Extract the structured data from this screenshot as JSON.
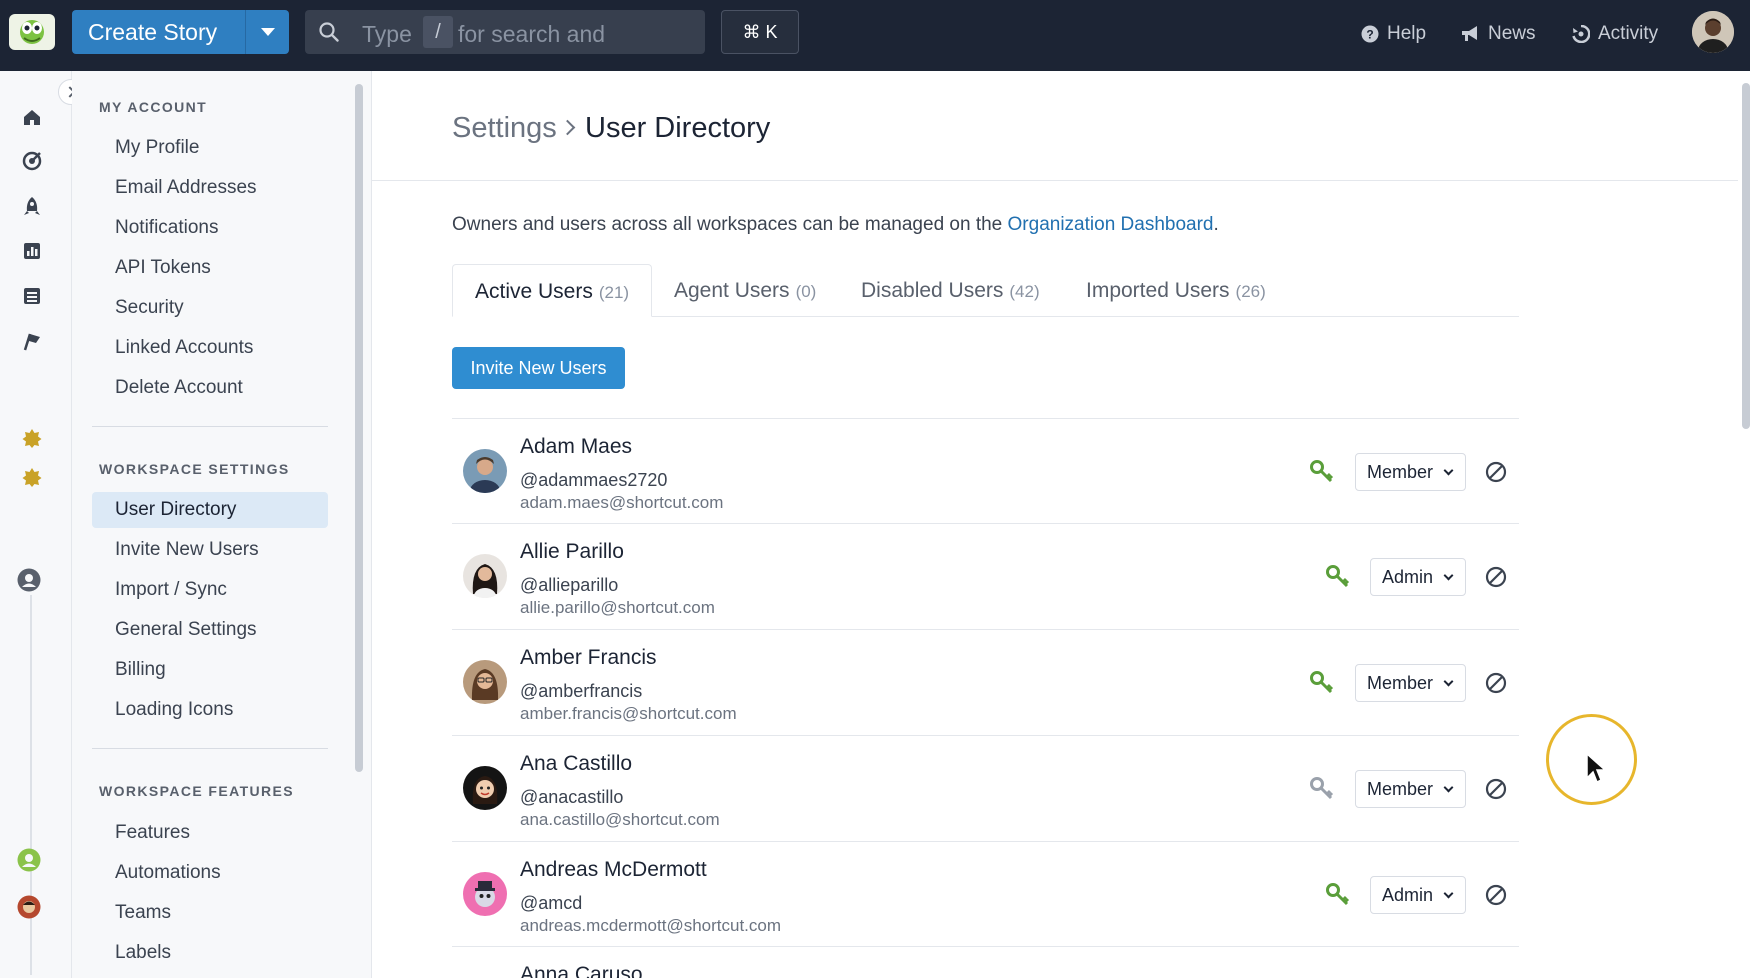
{
  "topbar": {
    "create_label": "Create Story",
    "search_type": "Type",
    "search_slash": "/",
    "search_rest": "for search and",
    "shortcut": "⌘ K",
    "help": "Help",
    "news": "News",
    "activity": "Activity"
  },
  "nav": {
    "my_account_heading": "MY ACCOUNT",
    "my_account_items": [
      "My Profile",
      "Email Addresses",
      "Notifications",
      "API Tokens",
      "Security",
      "Linked Accounts",
      "Delete Account"
    ],
    "workspace_settings_heading": "WORKSPACE SETTINGS",
    "workspace_settings_items": [
      "User Directory",
      "Invite New Users",
      "Import / Sync",
      "General Settings",
      "Billing",
      "Loading Icons"
    ],
    "workspace_features_heading": "WORKSPACE FEATURES",
    "workspace_features_items": [
      "Features",
      "Automations",
      "Teams",
      "Labels"
    ]
  },
  "breadcrumb": {
    "parent": "Settings",
    "current": "User Directory"
  },
  "intro": {
    "text_before": "Owners and users across all workspaces can be managed on the ",
    "link": "Organization Dashboard",
    "text_after": "."
  },
  "tabs": [
    {
      "label": "Active Users",
      "count": "(21)"
    },
    {
      "label": "Agent Users",
      "count": "(0)"
    },
    {
      "label": "Disabled Users",
      "count": "(42)"
    },
    {
      "label": "Imported Users",
      "count": "(26)"
    }
  ],
  "invite_label": "Invite New Users",
  "users": [
    {
      "name": "Adam Maes",
      "handle": "@adammaes2720",
      "email": "adam.maes@shortcut.com",
      "role": "Member",
      "key_active": true
    },
    {
      "name": "Allie Parillo",
      "handle": "@allieparillo",
      "email": "allie.parillo@shortcut.com",
      "role": "Admin",
      "key_active": true
    },
    {
      "name": "Amber Francis",
      "handle": "@amberfrancis",
      "email": "amber.francis@shortcut.com",
      "role": "Member",
      "key_active": true
    },
    {
      "name": "Ana Castillo",
      "handle": "@anacastillo",
      "email": "ana.castillo@shortcut.com",
      "role": "Member",
      "key_active": false
    },
    {
      "name": "Andreas McDermott",
      "handle": "@amcd",
      "email": "andreas.mcdermott@shortcut.com",
      "role": "Admin",
      "key_active": true
    },
    {
      "name": "Anna Caruso",
      "handle": "",
      "email": "",
      "role": "",
      "key_active": true
    }
  ],
  "colors": {
    "topbar": "#1c2434",
    "brand_blue": "#2f7fc1",
    "key_green": "#5a9e3a",
    "key_gray": "#9aa1ab",
    "active_nav": "#dce9f6",
    "cursor_ring": "#e7b62c"
  },
  "icons": {
    "rail": [
      "home-icon",
      "target-icon",
      "rocket-icon",
      "chart-icon",
      "document-icon",
      "flag-icon",
      "star-badge-icon",
      "star-badge-icon",
      "user-circle-icon",
      "user-green-icon",
      "avatar-icon"
    ]
  }
}
